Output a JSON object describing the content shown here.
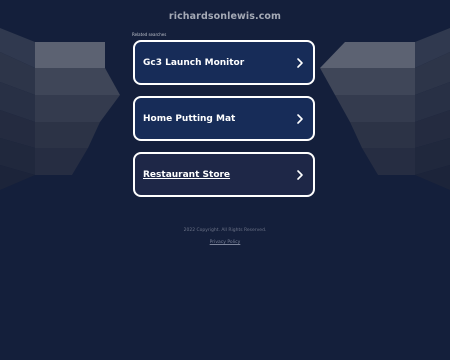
{
  "site": {
    "domain": "richardsonlewis.com"
  },
  "related": {
    "label": "Related searches",
    "items": [
      {
        "label": "Gc3 Launch Monitor"
      },
      {
        "label": "Home Putting Mat"
      },
      {
        "label": "Restaurant Store"
      }
    ]
  },
  "footer": {
    "copyright": "2022 Copyright. All Rights Reserved.",
    "privacy_label": "Privacy Policy"
  },
  "icons": {
    "link_chevron": "chevron-right-icon"
  },
  "colors": {
    "background": "#141f3b",
    "box_blue": "#172c58",
    "box_gray": "#1e2747",
    "border": "#ffffff"
  }
}
